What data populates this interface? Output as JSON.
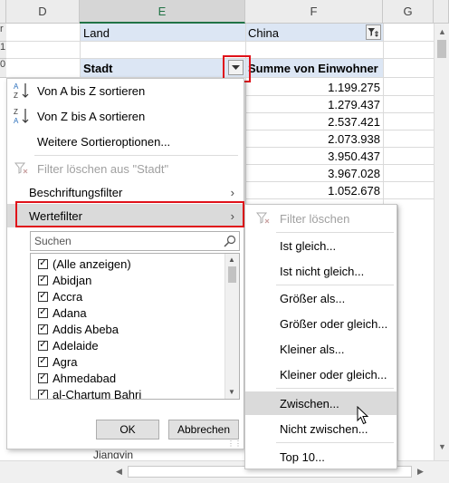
{
  "sheet": {
    "columns": [
      "D",
      "E",
      "F",
      "G"
    ],
    "row_stubs": [
      "r",
      "1",
      "0"
    ],
    "land_label": "Land",
    "land_value": "China",
    "header_city": "Stadt",
    "header_sum": "Summe von Einwohner",
    "values": [
      "1.199.275",
      "1.279.437",
      "2.537.421",
      "2.073.938",
      "3.950.437",
      "3.967.028",
      "1.052.678"
    ],
    "bottom_peek": "Jiangyin"
  },
  "menu": {
    "sort_az": "Von A bis Z sortieren",
    "sort_za": "Von Z bis A sortieren",
    "more_sort": "Weitere Sortieroptionen...",
    "clear_filter": "Filter löschen aus \"Stadt\"",
    "label_filter": "Beschriftungsfilter",
    "value_filter": "Wertefilter",
    "search_placeholder": "Suchen",
    "list_items": [
      "(Alle anzeigen)",
      "Abidjan",
      "Accra",
      "Adana",
      "Addis Abeba",
      "Adelaide",
      "Agra",
      "Ahmedabad",
      "al-Chartum Bahri"
    ],
    "ok": "OK",
    "cancel": "Abbrechen"
  },
  "submenu": {
    "clear": "Filter löschen",
    "equal": "Ist gleich...",
    "not_equal": "Ist nicht gleich...",
    "greater": "Größer als...",
    "greater_equal": "Größer oder gleich...",
    "less": "Kleiner als...",
    "less_equal": "Kleiner oder gleich...",
    "between": "Zwischen...",
    "not_between": "Nicht zwischen...",
    "top10": "Top 10..."
  },
  "colors": {
    "highlight_red": "#e0121a",
    "pivot_blue": "#dce6f4",
    "excel_green": "#217346"
  }
}
